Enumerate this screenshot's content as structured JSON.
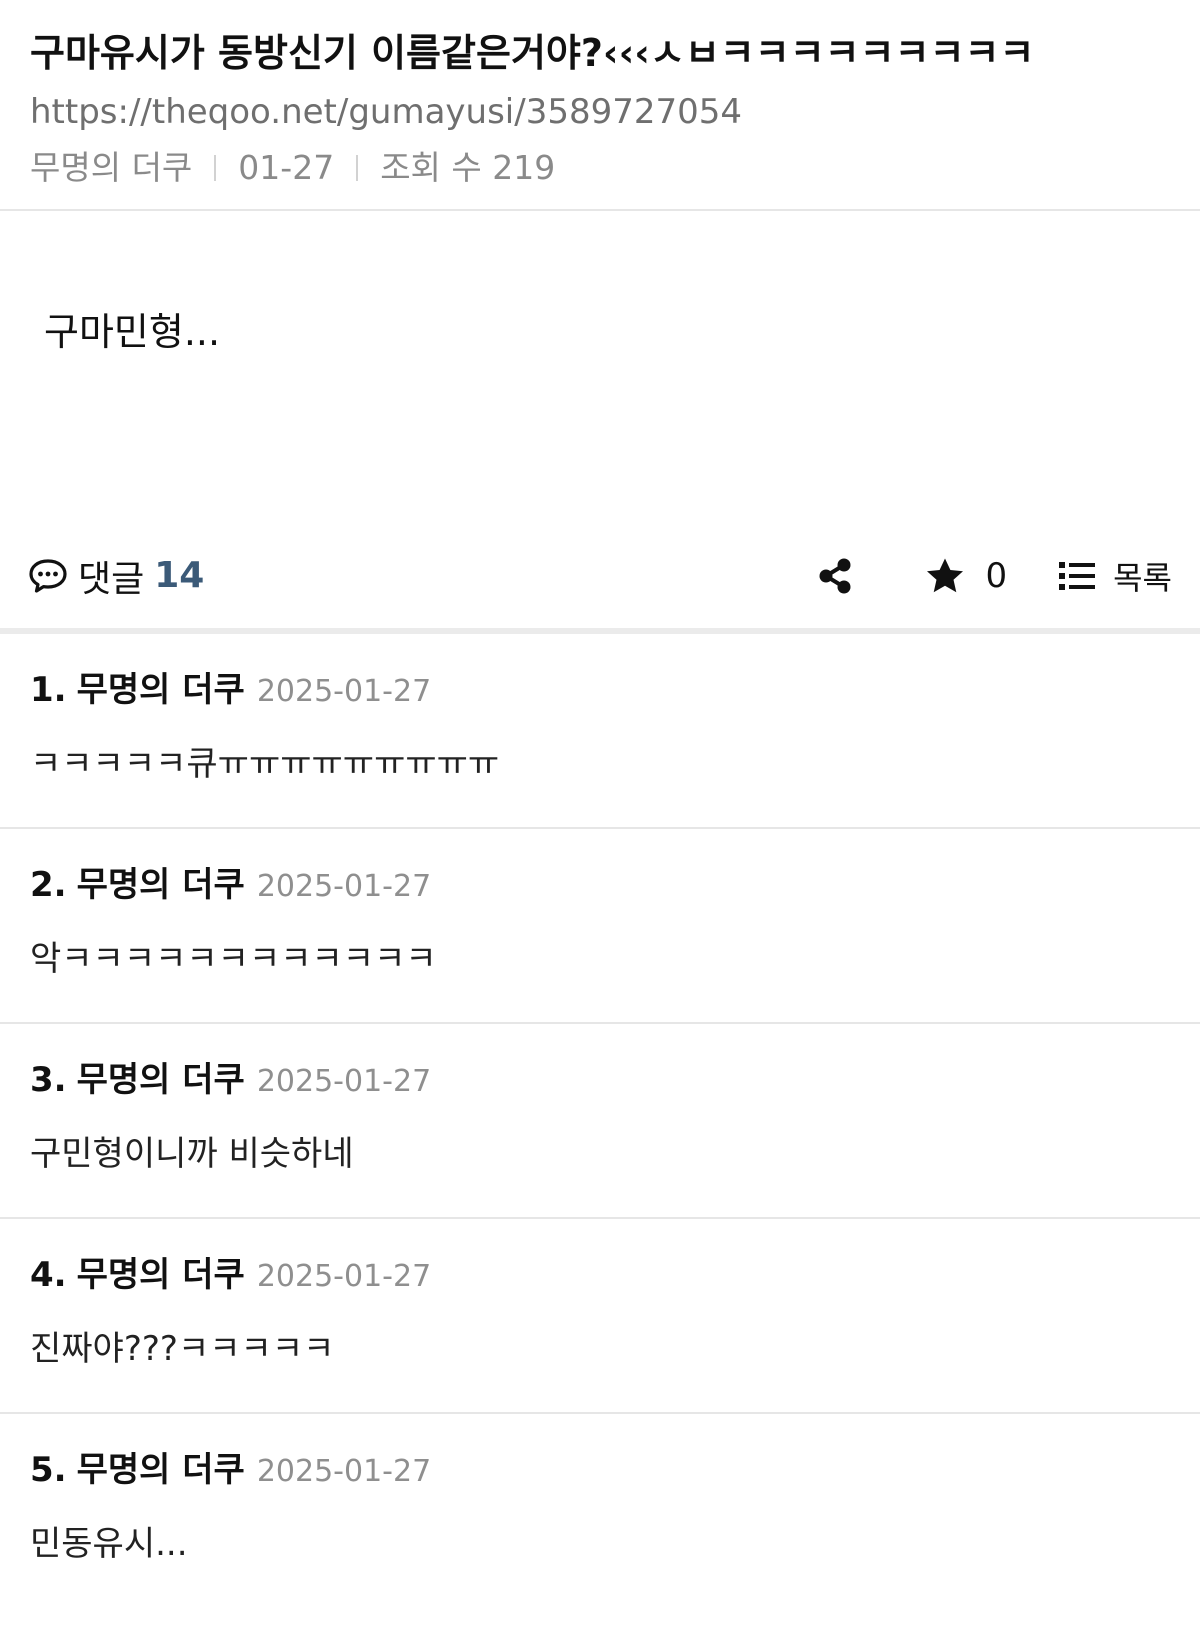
{
  "post": {
    "title": "구마유시가 동방신기 이름같은거야?‹‹‹ㅅㅂㅋㅋㅋㅋㅋㅋㅋㅋㅋ",
    "url": "https://theqoo.net/gumayusi/3589727054",
    "author": "무명의 더쿠",
    "date": "01-27",
    "views": "조회 수 219",
    "body": "구마민형..."
  },
  "actions": {
    "comment_icon": "speech-bubble-icon",
    "comment_label": "댓글",
    "comment_count": "14",
    "share_icon": "share-icon",
    "star_icon": "star-icon",
    "star_count": "0",
    "list_icon": "list-icon",
    "list_label": "목록"
  },
  "comments": [
    {
      "num": "1.",
      "author": "무명의 더쿠",
      "date": "2025-01-27",
      "text": "ㅋㅋㅋㅋㅋ큐ㅠㅠㅠㅠㅠㅠㅠㅠㅠ"
    },
    {
      "num": "2.",
      "author": "무명의 더쿠",
      "date": "2025-01-27",
      "text": "악ㅋㅋㅋㅋㅋㅋㅋㅋㅋㅋㅋㅋ"
    },
    {
      "num": "3.",
      "author": "무명의 더쿠",
      "date": "2025-01-27",
      "text": "구민형이니까 비슷하네"
    },
    {
      "num": "4.",
      "author": "무명의 더쿠",
      "date": "2025-01-27",
      "text": "진짜야???ㅋㅋㅋㅋㅋ"
    },
    {
      "num": "5.",
      "author": "무명의 더쿠",
      "date": "2025-01-27",
      "text": "민동유시..."
    }
  ],
  "colors": {
    "accent_count": "#3b5a78",
    "meta_text": "#8a8a8a",
    "divider": "#e6e6e6"
  }
}
